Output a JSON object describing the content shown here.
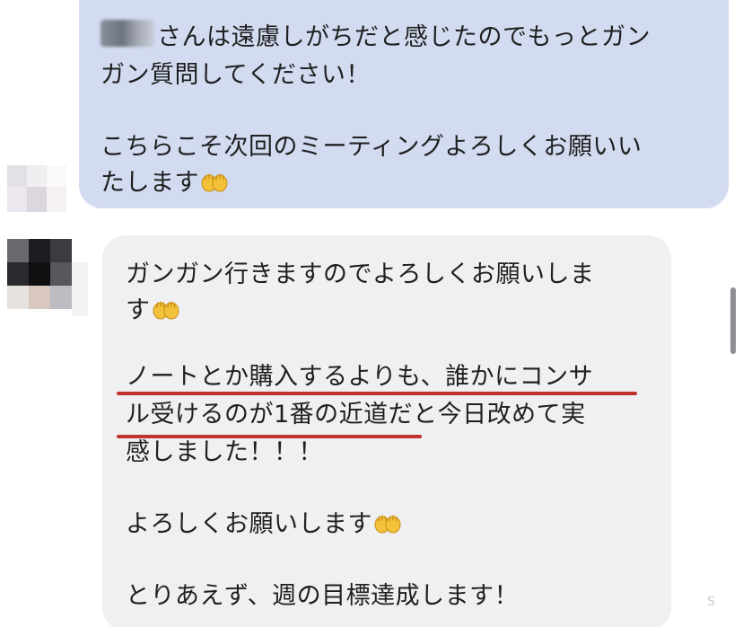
{
  "chat": {
    "sent_message": {
      "name_blurred": true,
      "lines": [
        "さんは遠慮しがちだと感じたのでもっとガン",
        "ガン質問してください！",
        "",
        "こちらこそ次回のミーティングよろしくお願いい",
        "たします"
      ],
      "emoji": "palms-up-together-icon"
    },
    "received_message": {
      "lines": [
        "ガンガン行きますのでよろしくお願いしま",
        "す",
        "",
        "ノートとか購入するよりも、誰かにコンサ",
        "ル受けるのが1番の近道だと今日改めて実",
        "感しました！！！",
        "",
        "よろしくお願いします",
        "",
        "とりあえず、週の目標達成します！"
      ],
      "highlight_color": "#c0322a"
    },
    "corner_mark": "S"
  },
  "colors": {
    "sent_bubble": "#d3dbf1",
    "received_bubble": "#f0f0f3",
    "text": "#1f1f1f",
    "underline": "#c0322a"
  }
}
